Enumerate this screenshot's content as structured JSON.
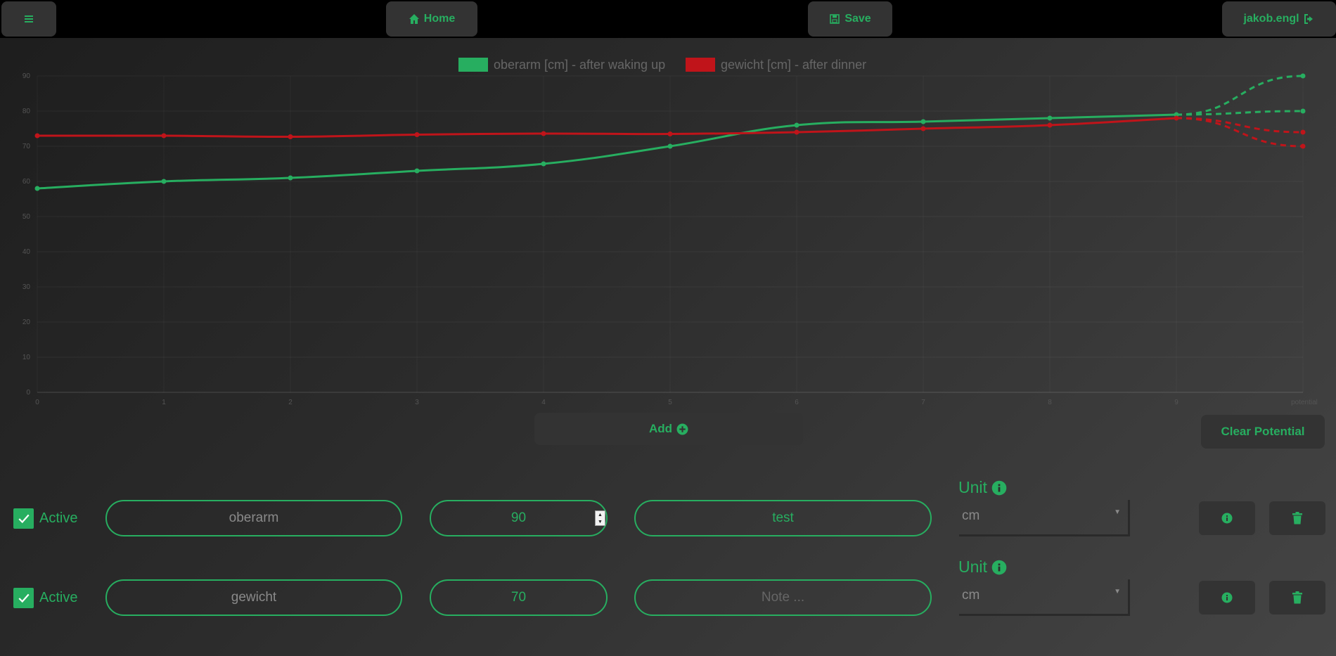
{
  "nav": {
    "menu_icon": "bars-icon",
    "home_label": "Home",
    "save_label": "Save",
    "user_label": "jakob.engl"
  },
  "colors": {
    "accent": "#27ae60",
    "series_red": "#c0141a",
    "button_bg": "#333333",
    "topbar_bg": "#000000"
  },
  "chart_data": {
    "type": "line",
    "legend": [
      "oberarm [cm] - after waking up",
      "gewicht [cm] - after dinner"
    ],
    "x_labels": [
      "0",
      "1",
      "2",
      "3",
      "4",
      "5",
      "6",
      "7",
      "8",
      "9",
      "potential"
    ],
    "y_ticks": [
      "0",
      "10",
      "20",
      "30",
      "40",
      "50",
      "60",
      "70",
      "80",
      "90"
    ],
    "ylim": [
      0,
      90
    ],
    "grid": true,
    "legend_position": "top",
    "series": [
      {
        "name": "oberarm [cm] - after waking up",
        "color": "#27ae60",
        "values": [
          58,
          60,
          61,
          63,
          65,
          70,
          76,
          77,
          78,
          79
        ],
        "potential_values": [
          90,
          80
        ]
      },
      {
        "name": "gewicht [cm] - after dinner",
        "color": "#c0141a",
        "values": [
          73,
          73,
          72.7,
          73.3,
          73.6,
          73.5,
          74,
          75,
          76,
          78
        ],
        "potential_values": [
          74,
          70
        ]
      }
    ]
  },
  "actions": {
    "add_label": "Add",
    "clear_potential_label": "Clear Potential"
  },
  "rows": [
    {
      "active_label": "Active",
      "name": "oberarm",
      "target": "90",
      "note": "test",
      "note_placeholder": "Note ...",
      "unit_label": "Unit",
      "unit": "cm"
    },
    {
      "active_label": "Active",
      "name": "gewicht",
      "target": "70",
      "note": "",
      "note_placeholder": "Note ...",
      "unit_label": "Unit",
      "unit": "cm"
    }
  ]
}
